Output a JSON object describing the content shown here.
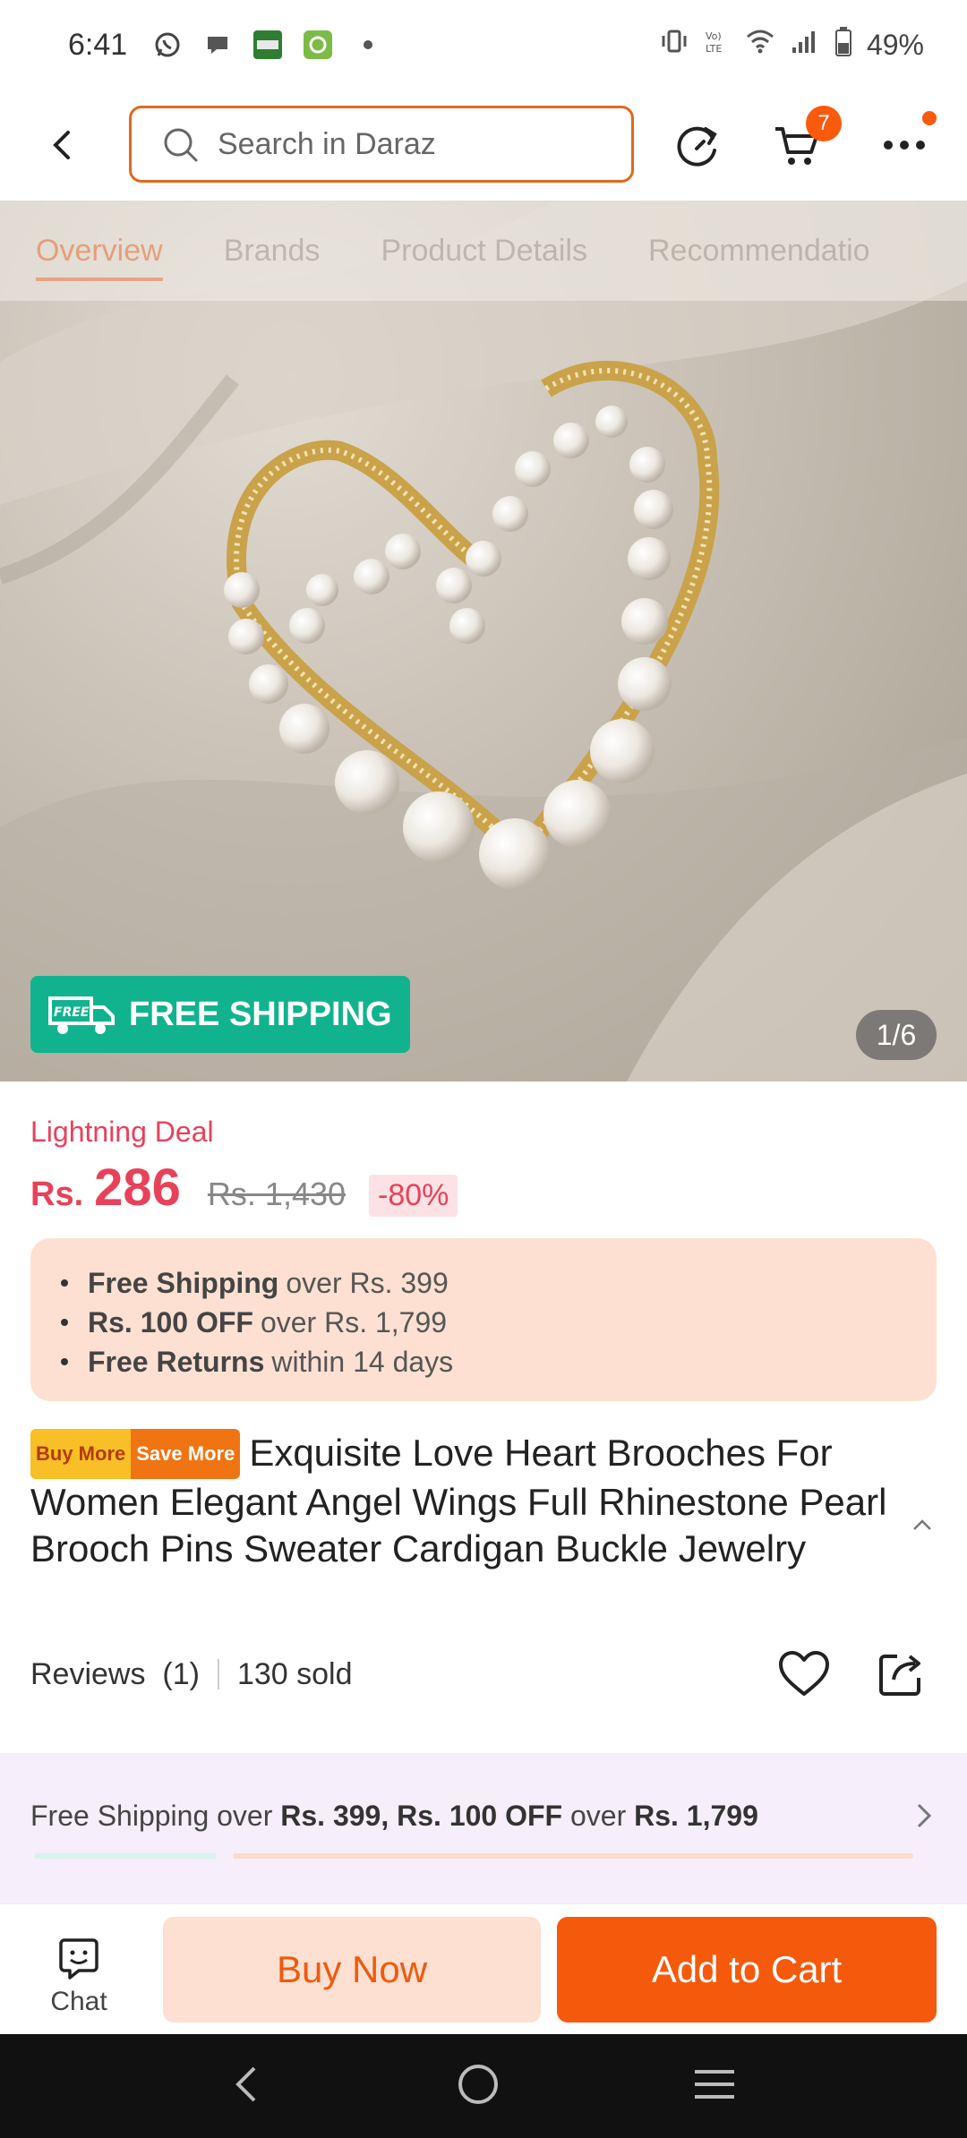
{
  "status_bar": {
    "time": "6:41",
    "left_icons": [
      "whatsapp-icon",
      "chat-bubble-icon",
      "english-status-app-icon",
      "refresh-app-icon",
      "dot-icon"
    ],
    "right_icons": [
      "vibrate-icon",
      "volte-icon",
      "wifi-icon",
      "signal-icon",
      "battery-icon"
    ],
    "battery": "49%"
  },
  "header": {
    "search_placeholder": "Search in Daraz",
    "cart_count": "7",
    "accent_color": "#fa5a0c"
  },
  "gallery": {
    "tabs": [
      "Overview",
      "Brands",
      "Product Details",
      "Recommendatio"
    ],
    "active_tab": "Overview",
    "badge_text": "FREE SHIPPING",
    "badge_icon_text": "FREE",
    "page_indicator": "1/6"
  },
  "price": {
    "deal_label": "Lightning Deal",
    "currency": "Rs.",
    "value": "286",
    "old_price": "Rs. 1,430",
    "discount": "-80%"
  },
  "promos": [
    {
      "bold": "Free Shipping",
      "rest": "over Rs. 399"
    },
    {
      "bold": "Rs. 100 OFF",
      "rest": "over Rs. 1,799"
    },
    {
      "bold": "Free Returns",
      "rest": "within 14 days"
    }
  ],
  "product": {
    "tag_buy_more": "Buy More",
    "tag_save_more": "Save More",
    "title": "Exquisite Love Heart Brooches For Women Elegant Angel Wings Full Rhinestone Pearl Brooch Pins Sweater Cardigan Buckle Jewelry",
    "reviews": "Reviews  (1)",
    "sold": "130 sold"
  },
  "shipping_banner": {
    "prefix": "Free Shipping over ",
    "bold_1": "Rs. 399, Rs. 100 OFF",
    "middle": " over ",
    "bold_2": "Rs. 1,799"
  },
  "actions": {
    "chat_label": "Chat",
    "buy_now": "Buy Now",
    "add_to_cart": "Add to Cart"
  }
}
